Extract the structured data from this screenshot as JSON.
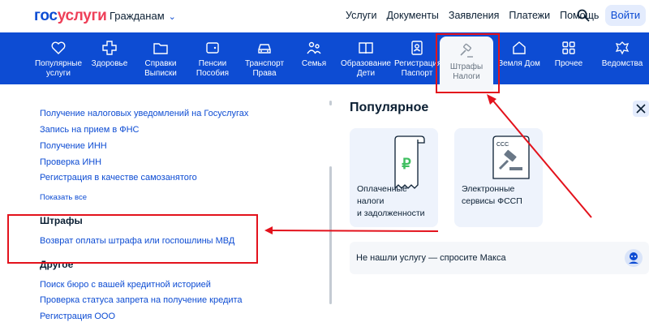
{
  "header": {
    "logo_part1": "гос",
    "logo_part2": "услуги",
    "audience": "Гражданам",
    "nav": [
      "Услуги",
      "Документы",
      "Заявления",
      "Платежи",
      "Помощь"
    ],
    "login": "Войти"
  },
  "categories": [
    {
      "label": "Популярные\nуслуги",
      "icon": "heart-icon"
    },
    {
      "label": "Здоровье",
      "icon": "cross-icon"
    },
    {
      "label": "Справки\nВыписки",
      "icon": "folder-icon"
    },
    {
      "label": "Пенсии\nПособия",
      "icon": "wallet-icon"
    },
    {
      "label": "Транспорт\nПрава",
      "icon": "car-icon"
    },
    {
      "label": "Семья",
      "icon": "family-icon"
    },
    {
      "label": "Образование\nДети",
      "icon": "book-icon"
    },
    {
      "label": "Регистрация\nПаспорт",
      "icon": "passport-icon"
    },
    {
      "label": "Штрафы\nНалоги",
      "icon": "gavel-icon"
    },
    {
      "label": "Земля Дом",
      "icon": "house-icon"
    },
    {
      "label": "Прочее",
      "icon": "grid-icon"
    },
    {
      "label": "Ведомства",
      "icon": "emblem-icon"
    }
  ],
  "left": {
    "links_top": [
      "Получение налоговых уведомлений на Госуслугах",
      "Запись на прием в ФНС",
      "Получение ИНН",
      "Проверка ИНН",
      "Регистрация в качестве самозанятого"
    ],
    "show_all": "Показать все",
    "section_fines": "Штрафы",
    "fines_link": "Возврат оплаты штрафа или госпошлины МВД",
    "section_other": "Другое",
    "other_links": [
      "Поиск бюро с вашей кредитной историей",
      "Проверка статуса запрета на получение кредита",
      "Регистрация ООО"
    ]
  },
  "right": {
    "popular_title": "Популярное",
    "card1": "Оплаченные\nналоги\nи задолженности",
    "card2": "Электронные\nсервисы ФССП",
    "ask": "Не нашли услугу — спросите Макса"
  },
  "colors": {
    "brand_blue": "#0d4cd3",
    "brand_red": "#ee3f58",
    "annotation_red": "#e3121c"
  }
}
